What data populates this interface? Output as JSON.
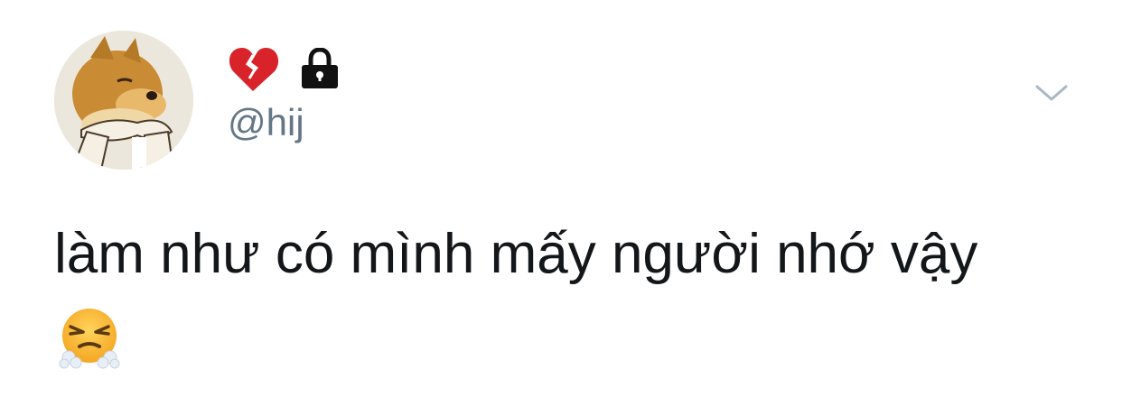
{
  "tweet": {
    "display_name_icons": [
      "broken-heart-icon",
      "lock-icon"
    ],
    "handle": "@hij",
    "text": "làm như có mình mấy người nhớ vậy",
    "trailing_emoji": "face-with-steam-from-nose-icon"
  },
  "colors": {
    "text": "#14171a",
    "handle": "#657786",
    "chevron": "#aab8c2",
    "heart": "#d8232a"
  }
}
